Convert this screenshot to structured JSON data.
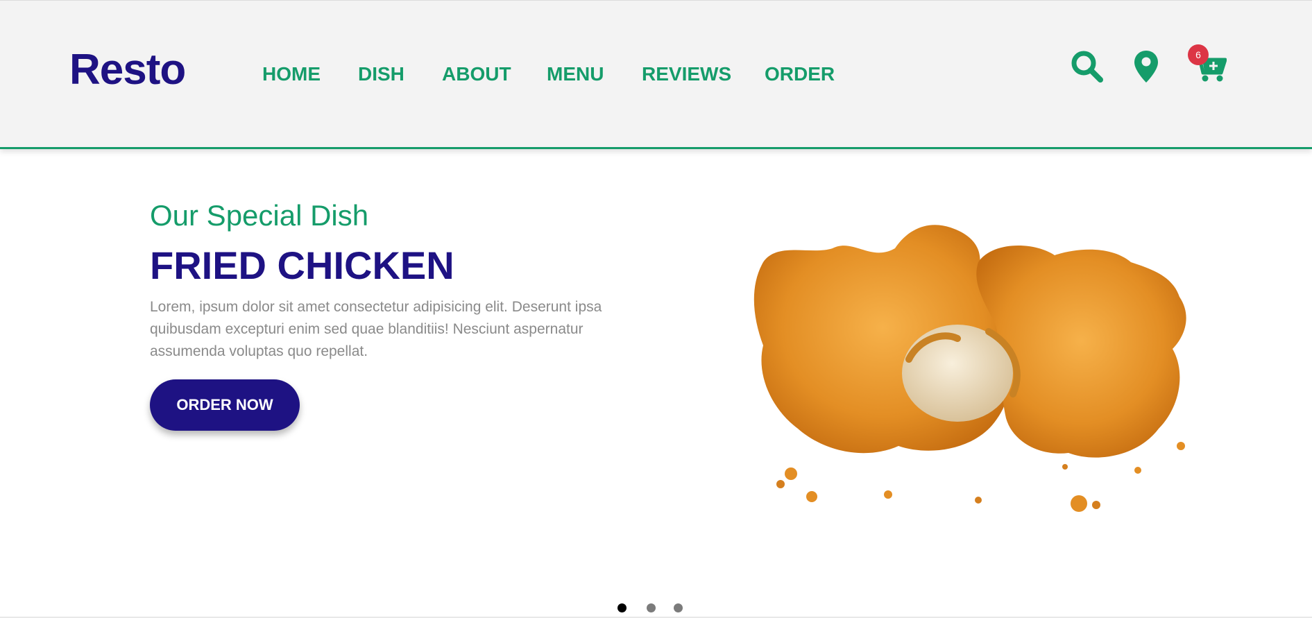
{
  "header": {
    "logo": "Resto",
    "nav": [
      "HOME",
      "DISH",
      "ABOUT",
      "MENU",
      "REVIEWS",
      "ORDER"
    ],
    "cart_count": "6",
    "icons": [
      "search-icon",
      "location-icon",
      "cart-icon"
    ],
    "accent_color": "#159c6a",
    "brand_color": "#1e1283",
    "badge_color": "#dc3545"
  },
  "hero": {
    "subtitle": "Our Special Dish",
    "title": "FRIED CHICKEN",
    "description": "Lorem, ipsum dolor sit amet consectetur adipisicing elit. Deserunt ipsa quibusdam excepturi enim sed quae blanditiis! Nesciunt aspernatur assumenda voluptas quo repellat.",
    "button_label": "ORDER NOW",
    "image": "fried-chicken-image"
  },
  "slider": {
    "slide_count": 3,
    "active_index": 0
  }
}
